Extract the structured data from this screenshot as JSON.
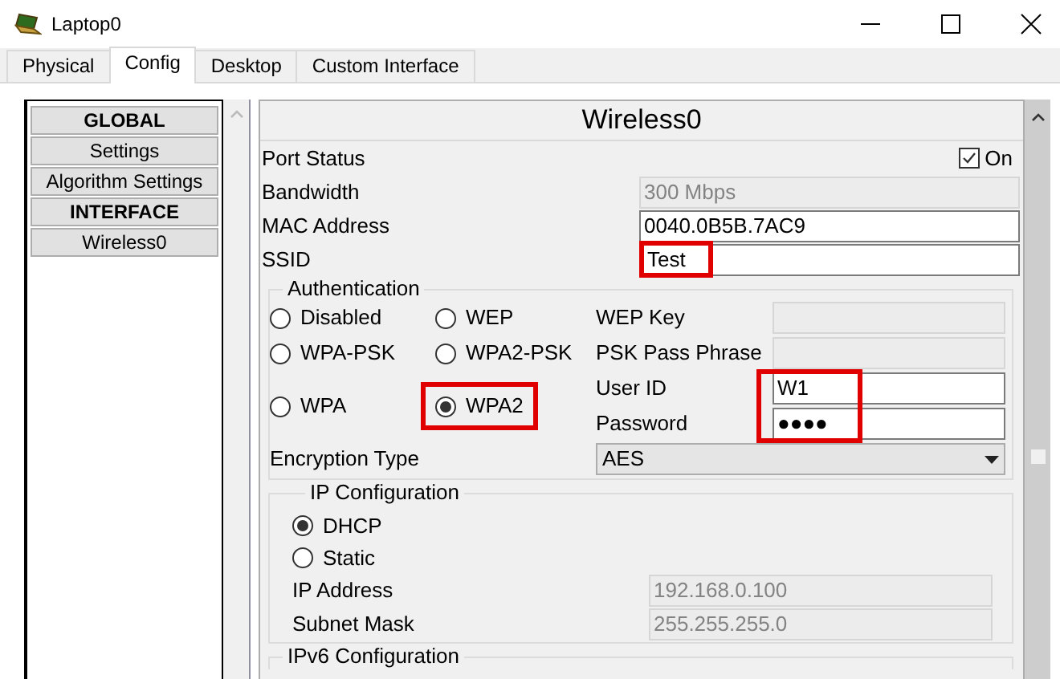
{
  "window": {
    "title": "Laptop0"
  },
  "tabs": [
    {
      "label": "Physical",
      "selected": false
    },
    {
      "label": "Config",
      "selected": true
    },
    {
      "label": "Desktop",
      "selected": false
    },
    {
      "label": "Custom Interface",
      "selected": false
    }
  ],
  "sidebar": {
    "items": [
      {
        "label": "GLOBAL",
        "kind": "header"
      },
      {
        "label": "Settings",
        "kind": "item"
      },
      {
        "label": "Algorithm Settings",
        "kind": "item"
      },
      {
        "label": "INTERFACE",
        "kind": "header"
      },
      {
        "label": "Wireless0",
        "kind": "item"
      }
    ]
  },
  "panel": {
    "title": "Wireless0",
    "port_status": {
      "label": "Port Status",
      "toggle_label": "On",
      "checked": true
    },
    "fields": [
      {
        "label": "Bandwidth",
        "value": "300 Mbps",
        "disabled": true,
        "highlighted": false
      },
      {
        "label": "MAC Address",
        "value": "0040.0B5B.7AC9",
        "disabled": false,
        "highlighted": false
      },
      {
        "label": "SSID",
        "value": "Test",
        "disabled": false,
        "highlighted": true
      }
    ],
    "authentication": {
      "title": "Authentication",
      "options": [
        {
          "label": "Disabled",
          "selected": false,
          "highlighted": false
        },
        {
          "label": "WEP",
          "selected": false,
          "highlighted": false
        },
        {
          "label": "WPA-PSK",
          "selected": false,
          "highlighted": false
        },
        {
          "label": "WPA2-PSK",
          "selected": false,
          "highlighted": false
        },
        {
          "label": "WPA",
          "selected": false,
          "highlighted": false
        },
        {
          "label": "WPA2",
          "selected": true,
          "highlighted": true
        }
      ],
      "fields": [
        {
          "label": "WEP Key",
          "disabled": true
        },
        {
          "label": "PSK Pass Phrase",
          "disabled": true
        },
        {
          "label": "User ID",
          "value": "W1",
          "disabled": false
        },
        {
          "label": "Password",
          "value": "●●●●",
          "disabled": false
        }
      ],
      "credentials_highlighted": true,
      "encryption": {
        "label": "Encryption Type",
        "value": "AES"
      }
    },
    "ip_configuration": {
      "title": "IP Configuration",
      "modes": [
        {
          "label": "DHCP",
          "selected": true
        },
        {
          "label": "Static",
          "selected": false
        }
      ],
      "fields": [
        {
          "label": "IP Address",
          "value": "192.168.0.100",
          "disabled": true
        },
        {
          "label": "Subnet Mask",
          "value": "255.255.255.0",
          "disabled": true
        }
      ]
    },
    "ipv6_configuration": {
      "title": "IPv6 Configuration"
    }
  }
}
